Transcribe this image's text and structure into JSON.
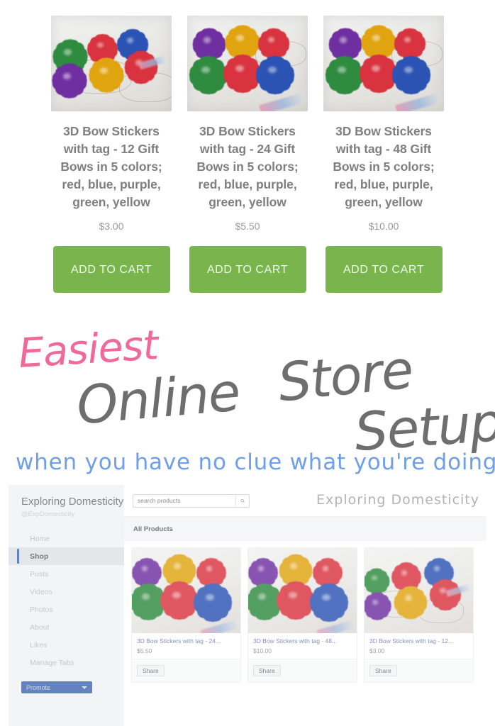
{
  "top_store": {
    "products": [
      {
        "title": "3D Bow Stickers with tag - 12 Gift Bows in 5 colors; red, blue, purple, green, yellow",
        "price": "$3.00",
        "add_to_cart": "ADD TO CART",
        "photo_alt": "bow-stickers-12-photo"
      },
      {
        "title": "3D Bow Stickers with tag - 24 Gift Bows in 5 colors; red, blue, purple, green, yellow",
        "price": "$5.50",
        "add_to_cart": "ADD TO CART",
        "photo_alt": "bow-stickers-24-photo"
      },
      {
        "title": "3D Bow Stickers with tag - 48 Gift Bows in 5 colors; red, blue, purple, green, yellow",
        "price": "$10.00",
        "add_to_cart": "ADD TO CART",
        "photo_alt": "bow-stickers-48-photo"
      }
    ]
  },
  "title_overlay": {
    "word_easiest": "Easiest",
    "word_online": "Online",
    "word_store": "Store",
    "word_setup": "Setup",
    "subtitle": "when you have no clue what you're doing",
    "color_pink": "#ef6a96",
    "color_gray": "#6e6e6e",
    "color_blue": "#6f9fe8"
  },
  "watermark": "Exploring Domesticity",
  "fb_panel": {
    "sidebar": {
      "page_name": "Exploring Domesticity",
      "handle": "@ExpDomesticity",
      "nav": [
        "Home",
        "Shop",
        "Posts",
        "Videos",
        "Photos",
        "About",
        "Likes",
        "Manage Tabs"
      ],
      "active_nav": "Shop",
      "promote_label": "Promote"
    },
    "search": {
      "placeholder": "search products",
      "value": ""
    },
    "section_header": "All Products",
    "cards": [
      {
        "title": "3D Bow Stickers with tag - 24...",
        "price": "$5.50",
        "share": "Share"
      },
      {
        "title": "3D Bow Stickers with tag - 48...",
        "price": "$10.00",
        "share": "Share"
      },
      {
        "title": "3D Bow Stickers with tag - 12...",
        "price": "$3.00",
        "share": "Share"
      }
    ]
  },
  "colors": {
    "cart_green": "#79b54c",
    "fb_blue": "#4267b2",
    "sidebar_bg": "#f0f2f5"
  }
}
